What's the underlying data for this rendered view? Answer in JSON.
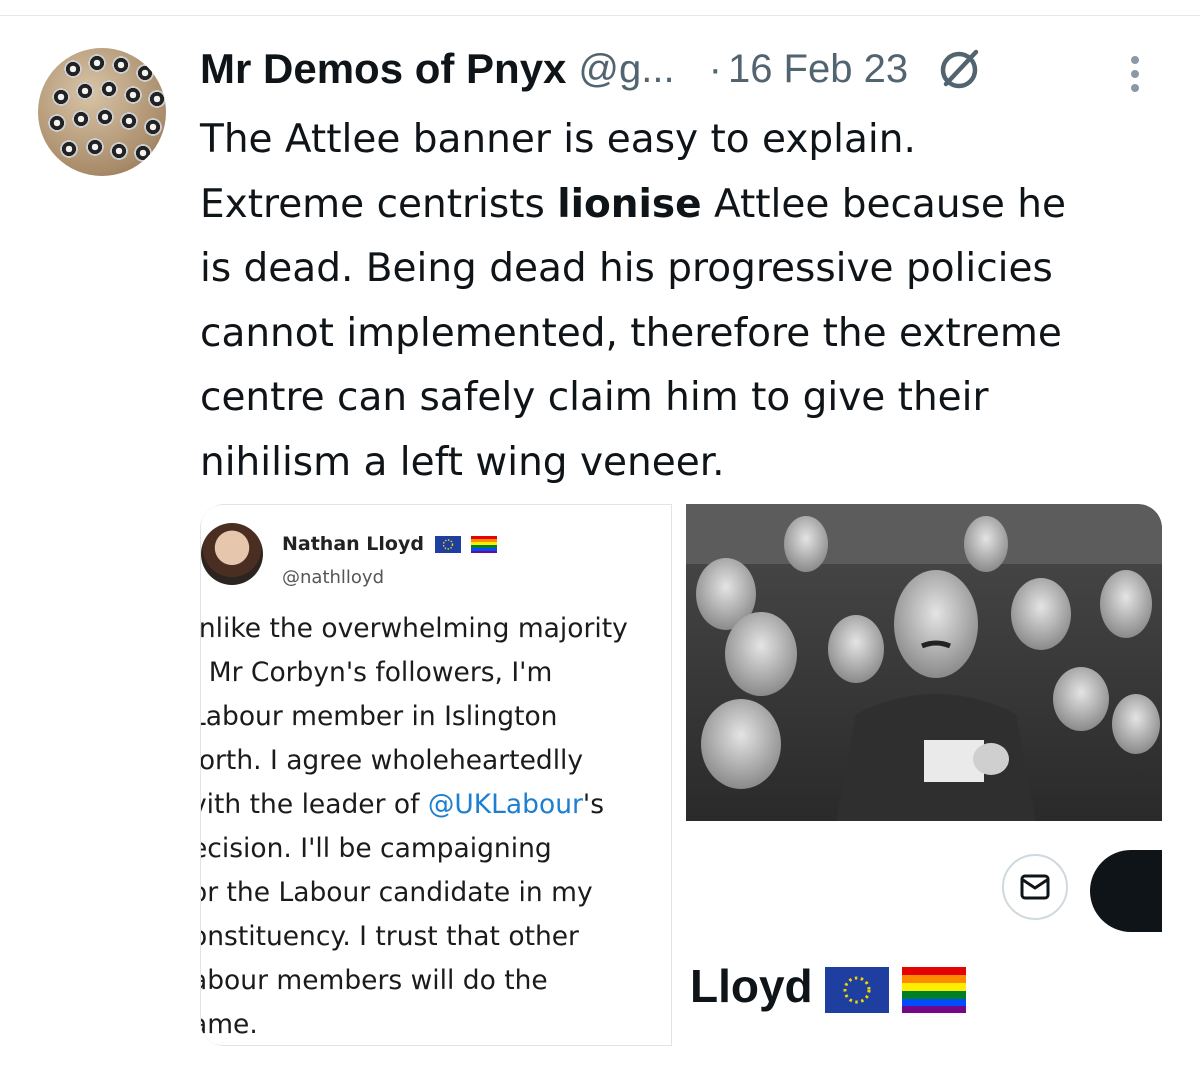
{
  "tweet": {
    "author": {
      "display_name": "Mr Demos of Pnyx",
      "handle": "@g...",
      "separator": "·",
      "date": "16 Feb 23"
    },
    "text": {
      "line1": "The Attlee banner is easy to explain.",
      "line2_before": "Extreme centrists ",
      "line2_bold": "lionise",
      "line2_after": " Attlee because he",
      "line3": "is dead. Being dead his progressive policies",
      "line4": "cannot implemented, therefore the extreme",
      "line5": "centre can safely claim him to give their",
      "line6": "nihilism a left wing veneer."
    },
    "icons": {
      "grok": "grok-icon",
      "more": "more-vertical-icon",
      "mail": "mail-icon"
    }
  },
  "quoted_screenshot": {
    "name": "Nathan Lloyd",
    "handle": "@nathlloyd",
    "lines": [
      "Inlike the overwhelming majority",
      "f Mr Corbyn's followers, I'm",
      " Labour member in Islington",
      "Iorth. I agree wholeheartedlly",
      "vith the leader of ",
      "ecision. I'll be campaigning",
      "or the Labour candidate in my",
      "onstituency. I trust that other",
      "abour members will do the",
      "ame."
    ],
    "mention": "@UKLabour",
    "mention_suffix": "'s"
  },
  "profile_screenshot": {
    "name": "Lloyd"
  },
  "colors": {
    "text": "#0f1419",
    "secondary": "#536471",
    "link": "#1d7fd0",
    "divider": "#e6e9ec"
  }
}
